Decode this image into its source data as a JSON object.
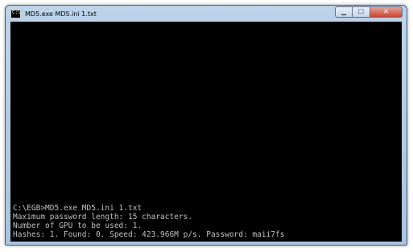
{
  "window": {
    "title": "MD5.exe MD5.ini 1.txt",
    "icon": "cmd-icon",
    "icon_glyph": "C:\\",
    "controls": {
      "minimize": "▁",
      "maximize": "☐",
      "close": "✕"
    }
  },
  "console": {
    "background": "#000000",
    "text_color": "#c0c0c0",
    "lines": [
      "C:\\EGB>MD5.exe MD5.ini 1.txt",
      "Maximum password length: 15 characters.",
      "Number of GPU to be used: 1.",
      "Hashes: 1. Found: 0. Speed: 423.966M p/s. Password: maii7fs"
    ]
  }
}
